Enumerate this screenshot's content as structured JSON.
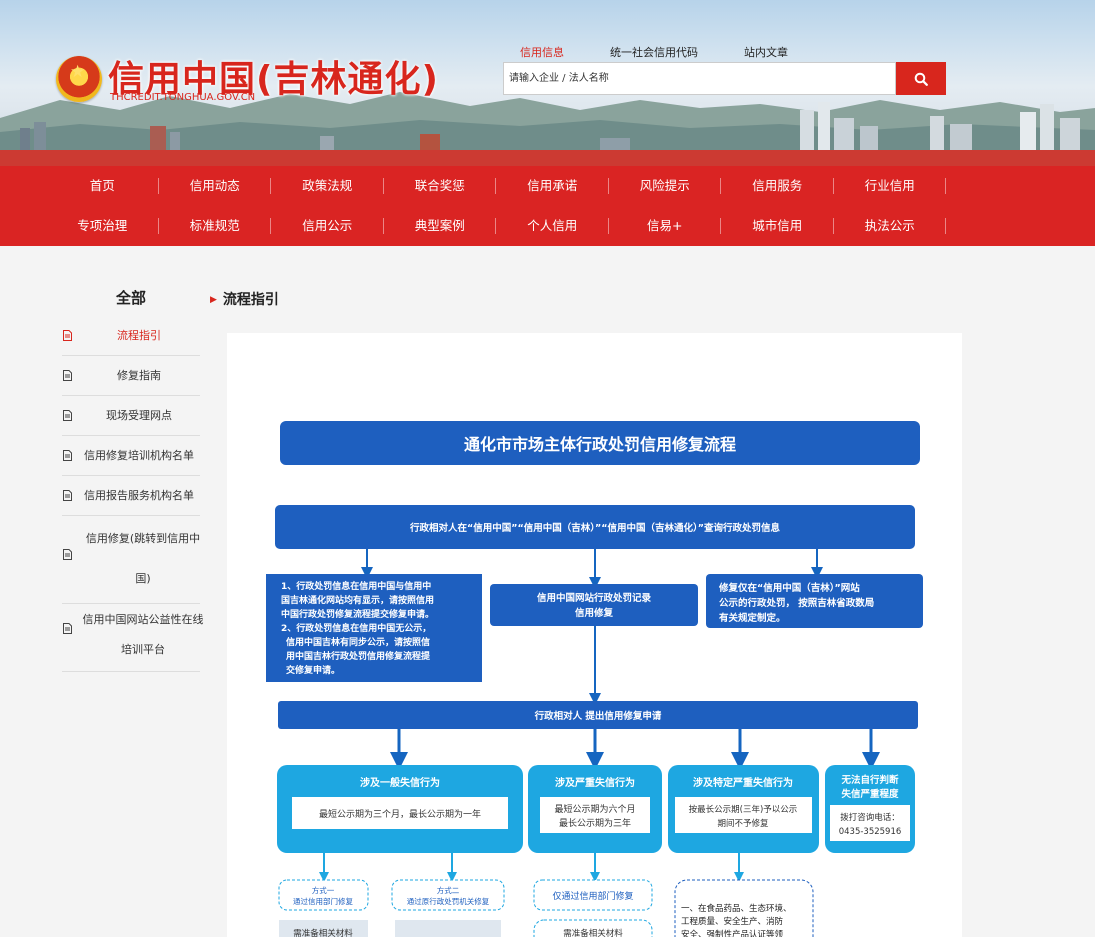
{
  "header": {
    "site_title": "信用中国(吉林通化)",
    "site_subtitle": "THCREDIT.TONGHUA.GOV.CN",
    "search_tabs": [
      "信用信息",
      "统一社会信用代码",
      "站内文章"
    ],
    "search_placeholder": "请输入企业 / 法人名称",
    "accent": "#d8261d"
  },
  "nav": {
    "row1": [
      "首页",
      "信用动态",
      "政策法规",
      "联合奖惩",
      "信用承诺",
      "风险提示",
      "信用服务",
      "行业信用"
    ],
    "row2": [
      "专项治理",
      "标准规范",
      "信用公示",
      "典型案例",
      "个人信用",
      "信易+",
      "城市信用",
      "执法公示"
    ],
    "bg": "#da2423"
  },
  "sidebar": {
    "title": "全部",
    "items": [
      {
        "label": "流程指引"
      },
      {
        "label": "修复指南"
      },
      {
        "label": "现场受理网点"
      },
      {
        "label": "信用修复培训机构名单"
      },
      {
        "label": "信用报告服务机构名单"
      },
      {
        "label_line1": "信用修复(跳转到信用中",
        "label_line2": "国)"
      },
      {
        "label_line1": "信用中国网站公益性在线",
        "label_line2": "培训平台"
      }
    ]
  },
  "content": {
    "breadcrumb": "流程指引"
  },
  "flowchart": {
    "title": "通化市市场主体行政处罚信用修复流程",
    "query_box": "行政相对人在“信用中国”“信用中国（吉林）”“信用中国（吉林通化）”查询行政处罚信息",
    "left_box": [
      "1、行政处罚信息在信用中国与信用中",
      "国吉林通化网站均有显示，请按照信用",
      "中国行政处罚修复流程提交修复申请。",
      "2、行政处罚信息在信用中国无公示，",
      "信用中国吉林有同步公示，请按照信",
      "用中国吉林行政处罚信用修复流程提",
      "交修复申请。"
    ],
    "center_box": [
      "信用中国网站行政处罚记录",
      "信用修复"
    ],
    "right_box": [
      "修复仅在“信用中国（吉林）”网站",
      "公示的行政处罚， 按照吉林省政数局",
      "有关规定制定。"
    ],
    "apply_box": "行政相对人 提出信用修复申请",
    "cat1": {
      "title": "涉及一般失信行为",
      "body": "最短公示期为三个月，最长公示期为一年"
    },
    "cat2": {
      "title": "涉及严重失信行为",
      "body": [
        "最短公示期为六个月",
        "最长公示期为三年"
      ]
    },
    "cat3": {
      "title": "涉及特定严重失信行为",
      "body": [
        "按最长公示期(三年)予以公示",
        "期间不予修复"
      ]
    },
    "cat4": {
      "title": [
        "无法自行判断",
        "失信严重程度"
      ],
      "body": [
        "拨打咨询电话：",
        "0435-3525916"
      ]
    },
    "way1": [
      "方式一",
      "通过信用部门修复"
    ],
    "way2": [
      "方式二",
      "通过原行政处罚机关修复"
    ],
    "only_credit": "仅通过信用部门修复",
    "prepare1": "需准备相关材料",
    "prepare2": "需准备相关材料",
    "special_note": [
      "一、在食品药品、生态环境、",
      "工程质量、安全生产、消防",
      "安全、强制性产品认证等领"
    ]
  }
}
